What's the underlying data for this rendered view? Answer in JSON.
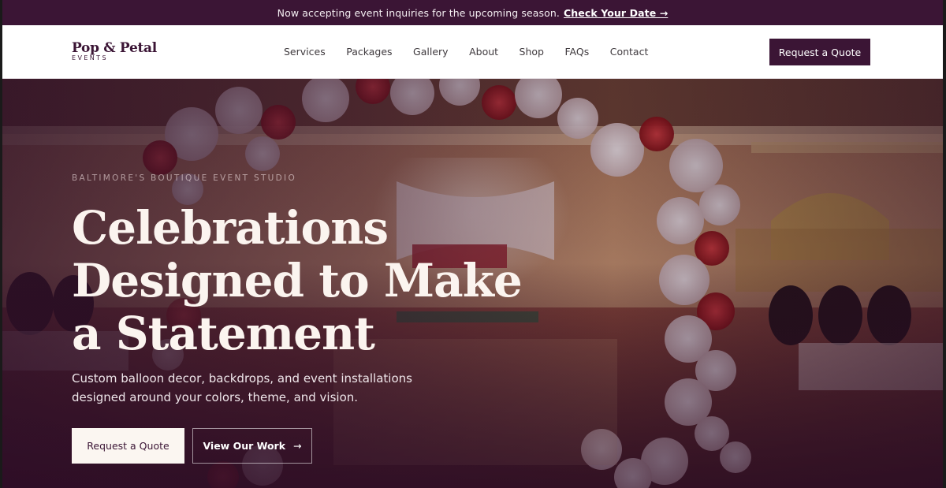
{
  "announcement": {
    "text": "Now accepting event inquiries for the upcoming season.",
    "link": "Check Your Date →"
  },
  "brand": {
    "name": "Pop & Petal",
    "sub": "EVENTS"
  },
  "nav": {
    "items": [
      "Services",
      "Packages",
      "Gallery",
      "About",
      "Shop",
      "FAQs",
      "Contact"
    ],
    "cta": "Request a Quote"
  },
  "hero": {
    "eyebrow": "BALTIMORE'S BOUTIQUE EVENT STUDIO",
    "headline": "Celebrations Designed to Make a Statement",
    "subcopy": "Custom balloon decor, backdrops, and event installations designed around your colors, theme, and vision.",
    "primary_cta": "Request a Quote",
    "secondary_cta": "View Our Work",
    "secondary_icon": "arrow-right-icon"
  },
  "colors": {
    "brand_plum": "#3b1535",
    "cream": "#fbf6f1"
  }
}
